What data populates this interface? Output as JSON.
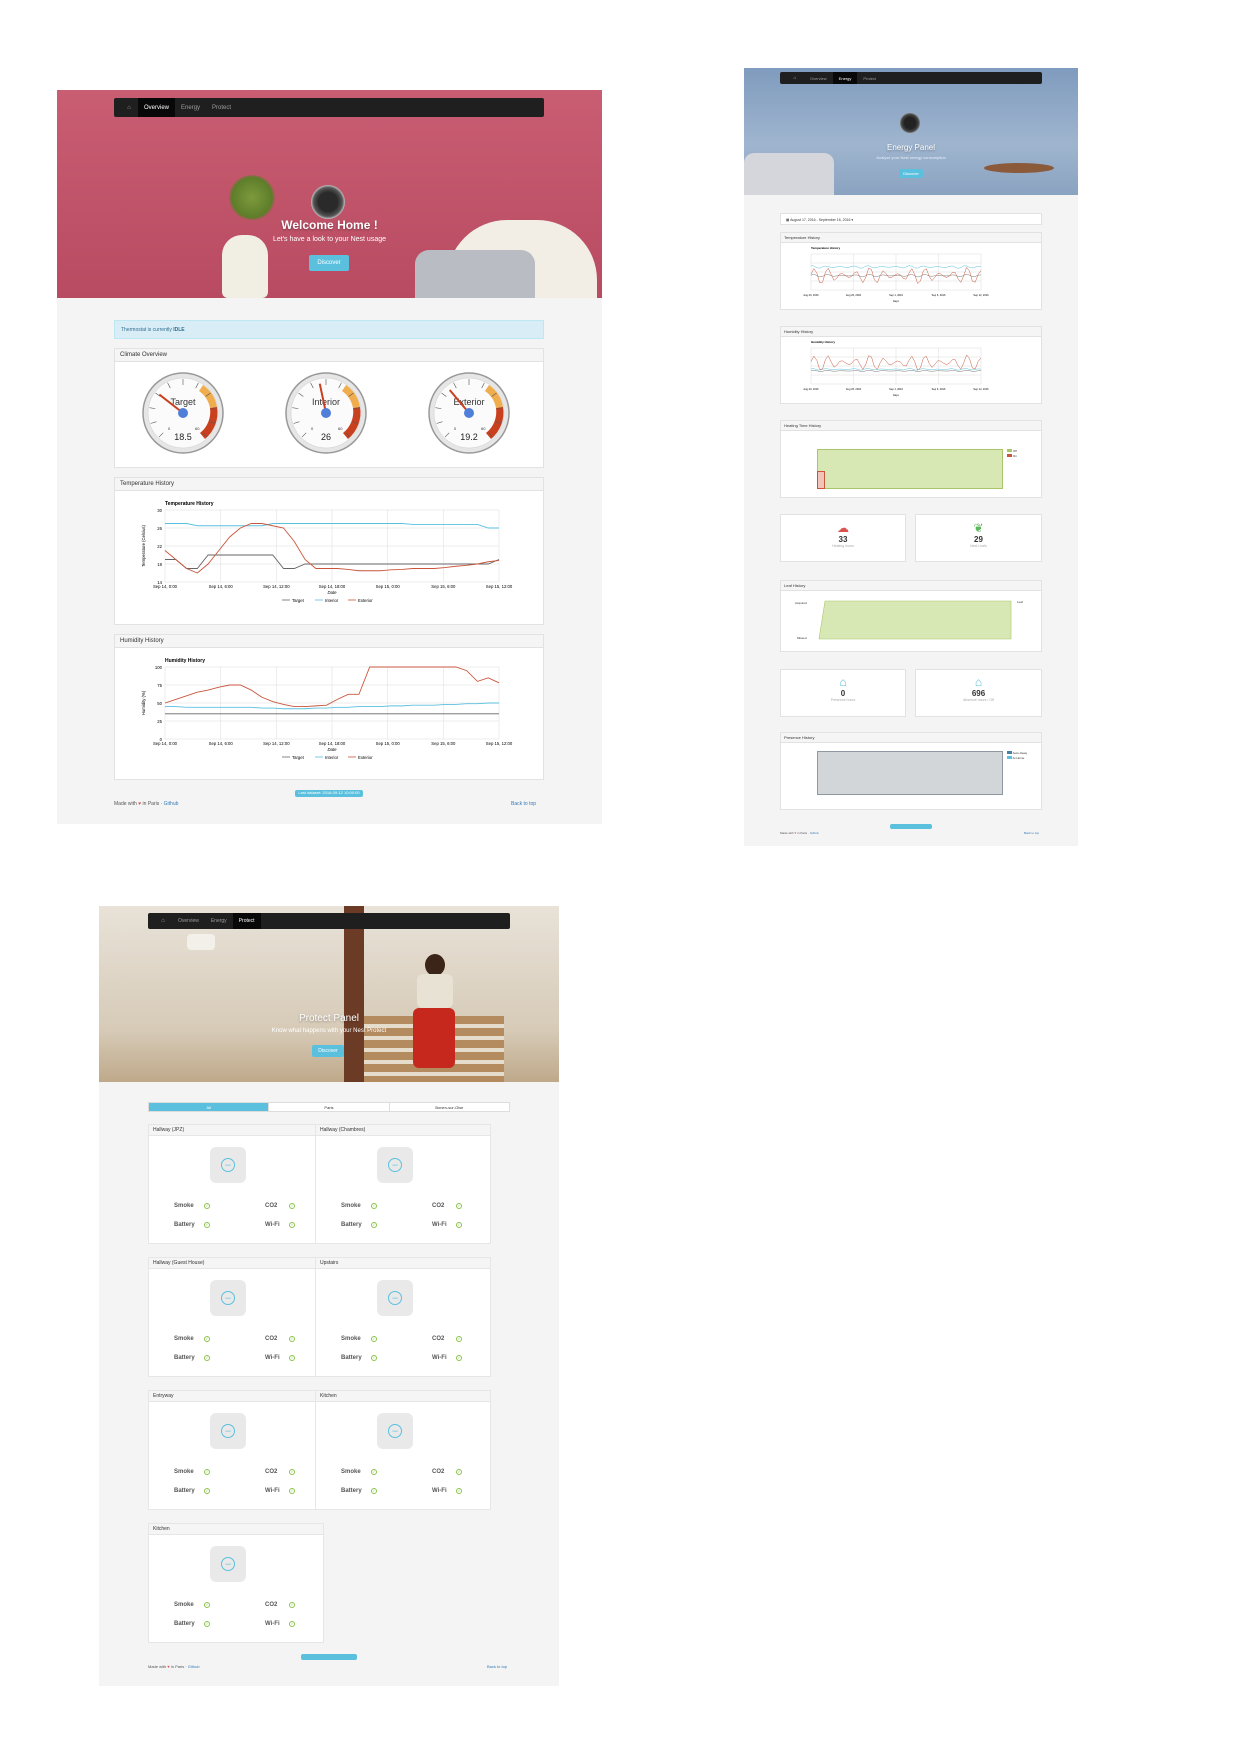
{
  "overview": {
    "nav": {
      "items": [
        "Overview",
        "Energy",
        "Protect"
      ],
      "active": "Overview"
    },
    "hero": {
      "title": "Welcome Home !",
      "subtitle": "Let's have a look to your Nest usage",
      "button": "Discover",
      "bg_color": "#c15267"
    },
    "alert": {
      "prefix": "Thermostat is currently ",
      "state": "IDLE"
    },
    "climate": {
      "heading": "Climate Overview",
      "gauges": [
        {
          "label": "Target",
          "value": "18.5"
        },
        {
          "label": "Interior",
          "value": "26"
        },
        {
          "label": "Exterior",
          "value": "19.2"
        }
      ],
      "scale_min": "0",
      "scale_max": "60"
    },
    "temperature": {
      "heading": "Temperature History",
      "chart_title": "Temperature History",
      "ylabel": "Temperature (Celsius)",
      "xlabel": "Date",
      "yticks": [
        "30",
        "26",
        "22",
        "18",
        "14"
      ],
      "xticks": [
        "Sep 14, 0:00",
        "Sep 14, 6:00",
        "Sep 14, 12:00",
        "Sep 14, 18:00",
        "Sep 15, 0:00",
        "Sep 15, 6:00",
        "Sep 15, 12:00"
      ],
      "legend": [
        "Target",
        "Interior",
        "Exterior"
      ]
    },
    "humidity": {
      "heading": "Humidity History",
      "chart_title": "Humidity History",
      "ylabel": "Humidity (%)",
      "xlabel": "Date",
      "yticks": [
        "100",
        "75",
        "50",
        "25",
        "0"
      ],
      "xticks": [
        "Sep 14, 0:00",
        "Sep 14, 6:00",
        "Sep 14, 12:00",
        "Sep 14, 18:00",
        "Sep 15, 0:00",
        "Sep 15, 6:00",
        "Sep 15, 12:00"
      ],
      "legend": [
        "Target",
        "Interior",
        "Exterior"
      ]
    },
    "badge": "Last dataset: 2016-09-12 10:00:00",
    "footer": {
      "made": "Made with",
      "in": "in Paris ·",
      "github": "Github",
      "back": "Back to top"
    }
  },
  "energy": {
    "nav": {
      "items": [
        "Overview",
        "Energy",
        "Protect"
      ],
      "active": "Energy"
    },
    "hero": {
      "title": "Energy Panel",
      "subtitle": "Analyse your Nest energy consumption",
      "button": "Discover"
    },
    "range": "August 17, 2016 - September 16, 2016",
    "panels": [
      "Temperature History",
      "Humidity History",
      "Heating Time History",
      "Leaf History",
      "Presence History"
    ],
    "stats": [
      {
        "value": "33",
        "label": "Heating hours",
        "icon": "cloud-fire-icon",
        "color": "#d9534f"
      },
      {
        "value": "29",
        "label": "Nest Leafs",
        "icon": "leaf-icon",
        "color": "#5cb85c"
      },
      {
        "value": "0",
        "label": "Presence hours",
        "icon": "home-icon",
        "color": "#5bc0de"
      },
      {
        "value": "696",
        "label": "Absence hours / Off",
        "icon": "away-icon",
        "color": "#5bc0de"
      }
    ],
    "heating_legend": [
      "Off",
      "On"
    ],
    "presence_legend": [
      "Auto-Away",
      "At Home"
    ],
    "leaf_legend": [
      "Leaf"
    ],
    "leaf_yticks": [
      "Acquired",
      "Missed"
    ],
    "xticks": [
      "Aug 20, 2016",
      "Aug 26, 2016",
      "Sep 1, 2016",
      "Sep 6, 2016",
      "Sep 12, 2016"
    ],
    "xlabel": "Days",
    "footer": {
      "made": "Made with",
      "in": "in Paris ·",
      "github": "Github",
      "back": "Back to top"
    }
  },
  "protect": {
    "nav": {
      "items": [
        "Overview",
        "Energy",
        "Protect"
      ],
      "active": "Protect"
    },
    "hero": {
      "title": "Protect Panel",
      "subtitle": "Know what happens with your Nest Protect",
      "button": "Discover"
    },
    "tabs": [
      "All",
      "Paris",
      "Bonen-sur-Oise"
    ],
    "status_labels": [
      "Smoke",
      "CO2",
      "Battery",
      "Wi-Fi"
    ],
    "device_logo": "nest",
    "devices": [
      "Hallway (JPZ)",
      "Hallway (Chambres)",
      "Hallway (Guest House)",
      "Upstairs",
      "Entryway",
      "Kitchen",
      "Kitchen"
    ],
    "badge": "Last dataset: 2016-09-16 10:00:00",
    "footer": {
      "made": "Made with",
      "in": "in Paris ·",
      "github": "Github",
      "back": "Back to top"
    }
  }
}
